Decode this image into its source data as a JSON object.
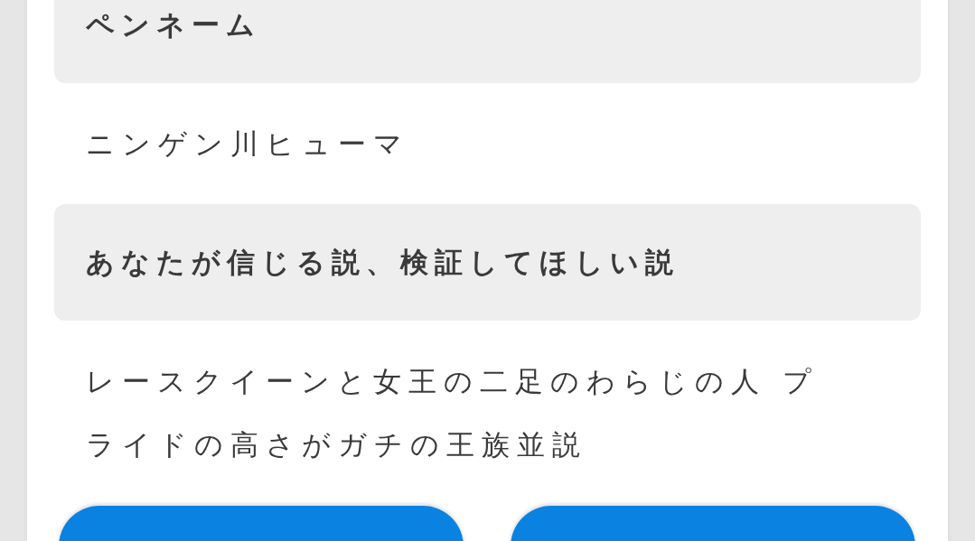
{
  "fields": [
    {
      "label": "ペンネーム",
      "value": "ニンゲン川ヒューマ"
    },
    {
      "label": "あなたが信じる説、検証してほしい説",
      "value": "レースクイーンと女王の二足のわらじの人 プライドの高さがガチの王族並説"
    }
  ],
  "buttons": [
    {
      "kind": "primary"
    },
    {
      "kind": "primary"
    }
  ]
}
